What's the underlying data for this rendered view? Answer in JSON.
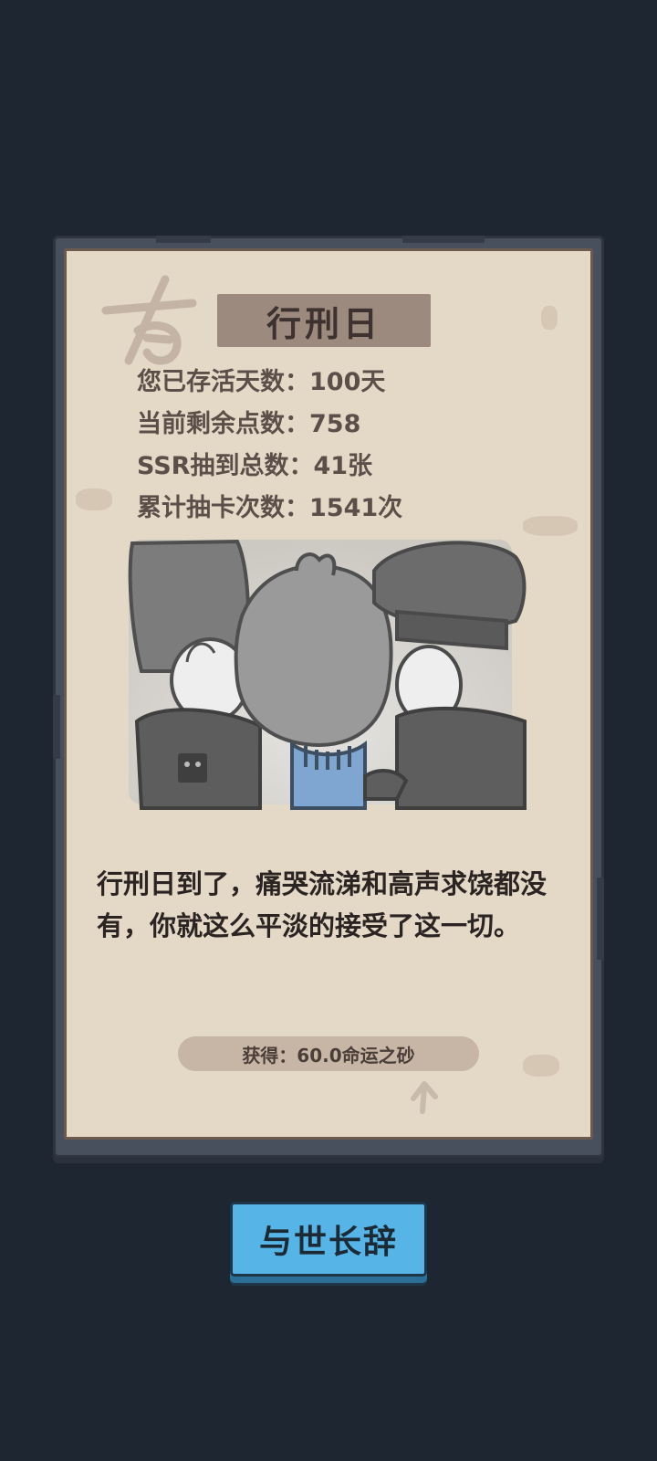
{
  "card": {
    "title": "行刑日",
    "stats": [
      {
        "text": "您已存活天数：100天"
      },
      {
        "text": "当前剩余点数：758"
      },
      {
        "text": "SSR抽到总数：41张"
      },
      {
        "text": "累计抽卡次数：1541次"
      }
    ],
    "story": "行刑日到了，痛哭流涕和高声求饶都没有，你就这么平淡的接受了这一切。",
    "reward": "获得：60.0命运之砂"
  },
  "action_button": {
    "label": "与世长辞"
  },
  "colors": {
    "background": "#1e2632",
    "parchment": "#e4d8c6",
    "banner": "#9d8a7e",
    "button": "#56b5e6"
  }
}
